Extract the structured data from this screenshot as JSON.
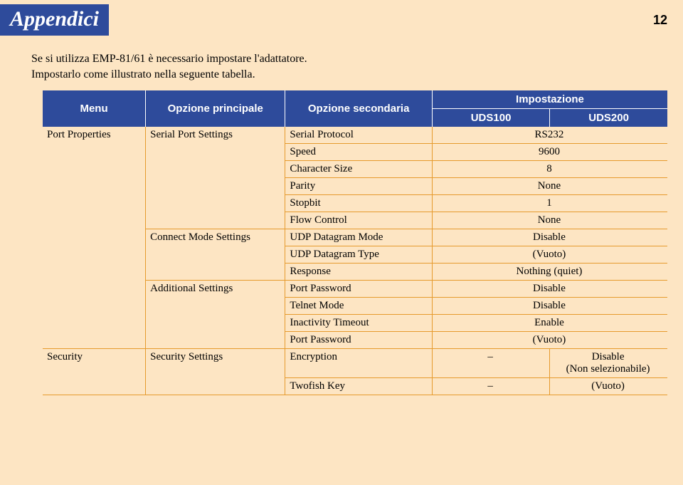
{
  "header": {
    "title": "Appendici",
    "page_number": "12"
  },
  "intro": {
    "line1": "Se si utilizza EMP-81/61 è necessario impostare l'adattatore.",
    "line2": "Impostarlo come illustrato nella seguente tabella."
  },
  "table": {
    "headers": {
      "menu": "Menu",
      "primary": "Opzione principale",
      "secondary": "Opzione secondaria",
      "setting": "Impostazione",
      "uds100": "UDS100",
      "uds200": "UDS200"
    },
    "rows": {
      "port_properties": "Port Properties",
      "serial_port_settings": "Serial Port Settings",
      "serial_protocol": "Serial Protocol",
      "serial_protocol_val": "RS232",
      "speed": "Speed",
      "speed_val": "9600",
      "char_size": "Character Size",
      "char_size_val": "8",
      "parity": "Parity",
      "parity_val": "None",
      "stopbit": "Stopbit",
      "stopbit_val": "1",
      "flow": "Flow Control",
      "flow_val": "None",
      "connect_mode": "Connect Mode Settings",
      "udp_mode": "UDP Datagram Mode",
      "udp_mode_val": "Disable",
      "udp_type": "UDP Datagram Type",
      "udp_type_val": "(Vuoto)",
      "response": "Response",
      "response_val": "Nothing (quiet)",
      "additional": "Additional Settings",
      "port_pw": "Port Password",
      "port_pw_val": "Disable",
      "telnet": "Telnet Mode",
      "telnet_val": "Disable",
      "inactivity": "Inactivity Timeout",
      "inactivity_val": "Enable",
      "port_pw2": "Port Password",
      "port_pw2_val": "(Vuoto)",
      "security": "Security",
      "security_settings": "Security Settings",
      "encryption": "Encryption",
      "encryption_v1": "–",
      "encryption_v2a": "Disable",
      "encryption_v2b": "(Non selezionabile)",
      "twofish": "Twofish Key",
      "twofish_v1": "–",
      "twofish_v2": "(Vuoto)"
    }
  }
}
